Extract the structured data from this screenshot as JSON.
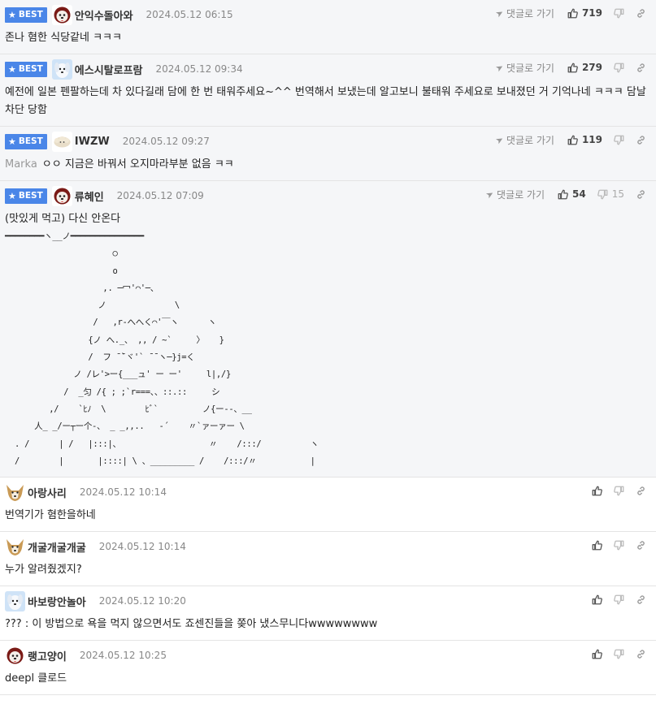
{
  "ui": {
    "best_label": "BEST",
    "reply_label": "댓글로 가기"
  },
  "best_comments": [
    {
      "nick": "안익수돌아와",
      "date": "2024.05.12 06:15",
      "likes": "719",
      "avatar": "red-dog",
      "text": "존나 혐한 식당같네 ㅋㅋㅋ"
    },
    {
      "nick": "에스시탈로프람",
      "date": "2024.05.12 09:34",
      "likes": "279",
      "avatar": "blue-dog",
      "text": "예전에 일본 펜팔하는데 차 있다길래 담에 한 번 태워주세요~^^ 번역해서 보냈는데 알고보니 불태워 주세요로 보내졌던 거 기억나네 ㅋㅋㅋ 담날 차단 당함"
    },
    {
      "nick": "IWZW",
      "date": "2024.05.12 09:27",
      "likes": "119",
      "avatar": "sheep",
      "mention": "Marka",
      "text": "ㅇㅇ 지금은 바꿔서 오지마라부분 없음 ㅋㅋ"
    },
    {
      "nick": "류혜인",
      "date": "2024.05.12 07:09",
      "likes": "54",
      "dislikes": "15",
      "avatar": "red-dog",
      "text": "(맛있게 먹고) 다신 안온다",
      "ascii": "━━━━━━━━ヽ__ノ━━━━━━━━━━━━━━━\n                      ○\n                      o\n                    ,. ─冖'⌒'─、\n                   ノ              \\\n                  /   ,r‐へへく⌒'￣ヽ      ヽ\n                 {ノ へ._、 ,, / ~`     〉   }\n                 /  フ ̄ ̄`ヾ'` ̄ ̄ ヽ─}j=く\n              ノ /レ'>ー{___ュ' ー ー'     l|,/}\n            /  _匀 /{ ; ;`r===、、::.::     シ\n         ,/    `ﾋﾉ  \\        ﾋﾞ`         ノ{ー-‐、__\n      人_ _/ー┬ー个-、 _ _,,..   ‐´    〃`ァーァー \\\n  . /      | /   |:::|、                  〃    /:::/          ヽ\n  /        |       |::::| \\ 、_________ /    /:::/〃           |"
    }
  ],
  "comments": [
    {
      "nick": "아랑사리",
      "date": "2024.05.12 10:14",
      "avatar": "fox",
      "text": "번역기가 혐한을하네"
    },
    {
      "nick": "개굴개굴개굴",
      "date": "2024.05.12 10:14",
      "avatar": "fox",
      "text": "누가 알려줬겠지?"
    },
    {
      "nick": "바보랑안놀아",
      "date": "2024.05.12 10:20",
      "avatar": "blue-dog",
      "text": "??? : 이 방법으로 욕을 먹지 않으면서도 죠센진들을 쫒아 냈스무니다wwwwwwww"
    },
    {
      "nick": "랭고양이",
      "date": "2024.05.12 10:25",
      "avatar": "red-dog",
      "text": "deepl 클로드"
    }
  ],
  "colors": {
    "best_badge": "#4a86e8",
    "best_bg": "#f5f6f8"
  }
}
